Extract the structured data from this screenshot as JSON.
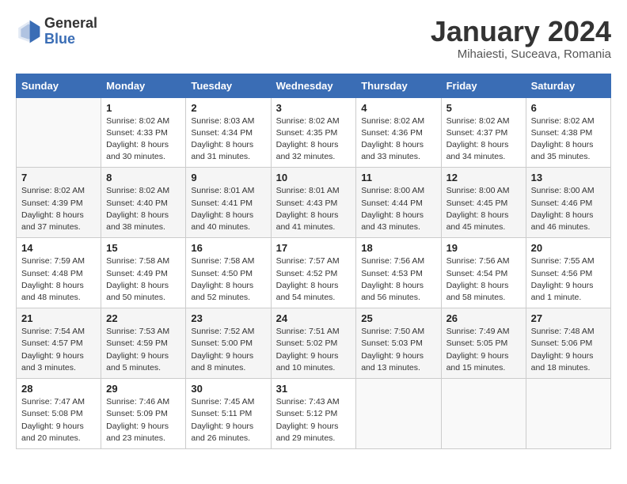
{
  "header": {
    "logo_general": "General",
    "logo_blue": "Blue",
    "month_year": "January 2024",
    "location": "Mihaiesti, Suceava, Romania"
  },
  "columns": [
    "Sunday",
    "Monday",
    "Tuesday",
    "Wednesday",
    "Thursday",
    "Friday",
    "Saturday"
  ],
  "weeks": [
    [
      {
        "day": "",
        "info": ""
      },
      {
        "day": "1",
        "info": "Sunrise: 8:02 AM\nSunset: 4:33 PM\nDaylight: 8 hours\nand 30 minutes."
      },
      {
        "day": "2",
        "info": "Sunrise: 8:03 AM\nSunset: 4:34 PM\nDaylight: 8 hours\nand 31 minutes."
      },
      {
        "day": "3",
        "info": "Sunrise: 8:02 AM\nSunset: 4:35 PM\nDaylight: 8 hours\nand 32 minutes."
      },
      {
        "day": "4",
        "info": "Sunrise: 8:02 AM\nSunset: 4:36 PM\nDaylight: 8 hours\nand 33 minutes."
      },
      {
        "day": "5",
        "info": "Sunrise: 8:02 AM\nSunset: 4:37 PM\nDaylight: 8 hours\nand 34 minutes."
      },
      {
        "day": "6",
        "info": "Sunrise: 8:02 AM\nSunset: 4:38 PM\nDaylight: 8 hours\nand 35 minutes."
      }
    ],
    [
      {
        "day": "7",
        "info": "Sunrise: 8:02 AM\nSunset: 4:39 PM\nDaylight: 8 hours\nand 37 minutes."
      },
      {
        "day": "8",
        "info": "Sunrise: 8:02 AM\nSunset: 4:40 PM\nDaylight: 8 hours\nand 38 minutes."
      },
      {
        "day": "9",
        "info": "Sunrise: 8:01 AM\nSunset: 4:41 PM\nDaylight: 8 hours\nand 40 minutes."
      },
      {
        "day": "10",
        "info": "Sunrise: 8:01 AM\nSunset: 4:43 PM\nDaylight: 8 hours\nand 41 minutes."
      },
      {
        "day": "11",
        "info": "Sunrise: 8:00 AM\nSunset: 4:44 PM\nDaylight: 8 hours\nand 43 minutes."
      },
      {
        "day": "12",
        "info": "Sunrise: 8:00 AM\nSunset: 4:45 PM\nDaylight: 8 hours\nand 45 minutes."
      },
      {
        "day": "13",
        "info": "Sunrise: 8:00 AM\nSunset: 4:46 PM\nDaylight: 8 hours\nand 46 minutes."
      }
    ],
    [
      {
        "day": "14",
        "info": "Sunrise: 7:59 AM\nSunset: 4:48 PM\nDaylight: 8 hours\nand 48 minutes."
      },
      {
        "day": "15",
        "info": "Sunrise: 7:58 AM\nSunset: 4:49 PM\nDaylight: 8 hours\nand 50 minutes."
      },
      {
        "day": "16",
        "info": "Sunrise: 7:58 AM\nSunset: 4:50 PM\nDaylight: 8 hours\nand 52 minutes."
      },
      {
        "day": "17",
        "info": "Sunrise: 7:57 AM\nSunset: 4:52 PM\nDaylight: 8 hours\nand 54 minutes."
      },
      {
        "day": "18",
        "info": "Sunrise: 7:56 AM\nSunset: 4:53 PM\nDaylight: 8 hours\nand 56 minutes."
      },
      {
        "day": "19",
        "info": "Sunrise: 7:56 AM\nSunset: 4:54 PM\nDaylight: 8 hours\nand 58 minutes."
      },
      {
        "day": "20",
        "info": "Sunrise: 7:55 AM\nSunset: 4:56 PM\nDaylight: 9 hours\nand 1 minute."
      }
    ],
    [
      {
        "day": "21",
        "info": "Sunrise: 7:54 AM\nSunset: 4:57 PM\nDaylight: 9 hours\nand 3 minutes."
      },
      {
        "day": "22",
        "info": "Sunrise: 7:53 AM\nSunset: 4:59 PM\nDaylight: 9 hours\nand 5 minutes."
      },
      {
        "day": "23",
        "info": "Sunrise: 7:52 AM\nSunset: 5:00 PM\nDaylight: 9 hours\nand 8 minutes."
      },
      {
        "day": "24",
        "info": "Sunrise: 7:51 AM\nSunset: 5:02 PM\nDaylight: 9 hours\nand 10 minutes."
      },
      {
        "day": "25",
        "info": "Sunrise: 7:50 AM\nSunset: 5:03 PM\nDaylight: 9 hours\nand 13 minutes."
      },
      {
        "day": "26",
        "info": "Sunrise: 7:49 AM\nSunset: 5:05 PM\nDaylight: 9 hours\nand 15 minutes."
      },
      {
        "day": "27",
        "info": "Sunrise: 7:48 AM\nSunset: 5:06 PM\nDaylight: 9 hours\nand 18 minutes."
      }
    ],
    [
      {
        "day": "28",
        "info": "Sunrise: 7:47 AM\nSunset: 5:08 PM\nDaylight: 9 hours\nand 20 minutes."
      },
      {
        "day": "29",
        "info": "Sunrise: 7:46 AM\nSunset: 5:09 PM\nDaylight: 9 hours\nand 23 minutes."
      },
      {
        "day": "30",
        "info": "Sunrise: 7:45 AM\nSunset: 5:11 PM\nDaylight: 9 hours\nand 26 minutes."
      },
      {
        "day": "31",
        "info": "Sunrise: 7:43 AM\nSunset: 5:12 PM\nDaylight: 9 hours\nand 29 minutes."
      },
      {
        "day": "",
        "info": ""
      },
      {
        "day": "",
        "info": ""
      },
      {
        "day": "",
        "info": ""
      }
    ]
  ]
}
